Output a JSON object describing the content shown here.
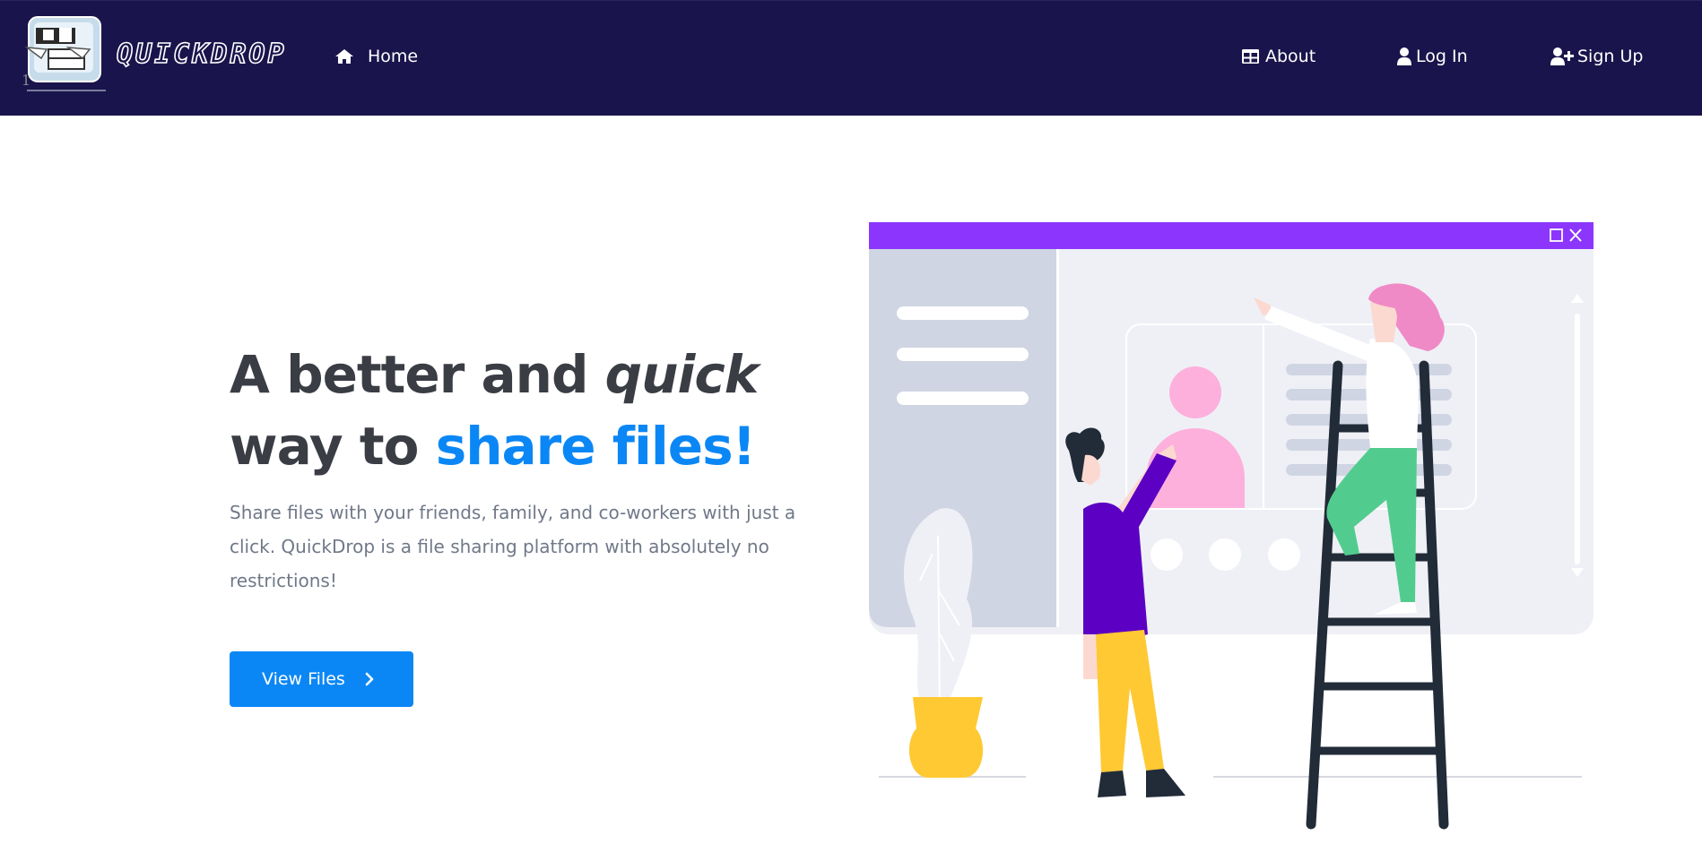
{
  "brand": {
    "name": "QUICKDROP"
  },
  "nav": {
    "home": "Home",
    "about": "About",
    "login": "Log In",
    "signup": "Sign Up"
  },
  "hero": {
    "title_part1": "A better and ",
    "title_italic": "quick",
    "title_part2": "way to ",
    "title_accent": "share files!",
    "description": "Share files with your friends, family, and co-workers with just a click. QuickDrop is a file sharing platform with absolutely no restrictions!",
    "cta_label": "View Files"
  },
  "icons": {
    "home": "home-icon",
    "about": "table-icon",
    "login": "user-icon",
    "signup": "user-plus-icon",
    "cta": "chevron-right-icon"
  },
  "colors": {
    "navbar": "#1a144c",
    "accent": "#0b87f5",
    "title": "#3b3d45",
    "text_muted": "#707888",
    "window_bar": "#8c36fd"
  }
}
